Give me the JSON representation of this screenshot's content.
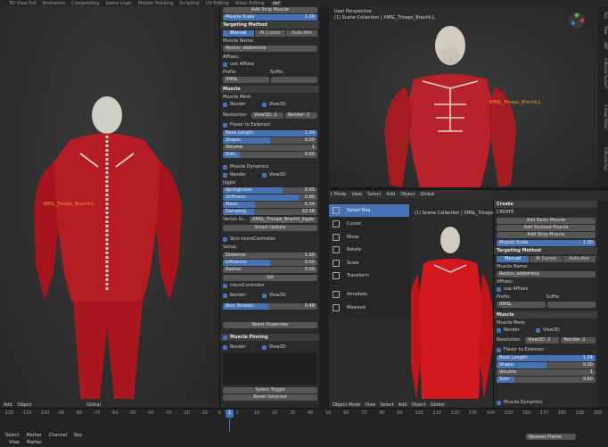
{
  "workspace_tabs": [
    "3D View Full",
    "Animation",
    "Compositing",
    "Game Logic",
    "Motion Tracking",
    "Scripting",
    "UV Editing",
    "Video Editing",
    "def"
  ],
  "left_viewport": {
    "bone_label": "XMSL_Triceps_Brachii.L",
    "footer": {
      "add": "Add",
      "object": "Object",
      "global": "Global"
    }
  },
  "top_right_viewport": {
    "title": "User Perspective",
    "subtitle": "(1) Scene Collection | XMSL_Triceps_Brachii.L",
    "bone_label": "XMSL_Triceps_Brachii.L",
    "side_tabs": [
      "Tool",
      "View",
      "ARP",
      "X-Muscle System",
      "X-Poser Picker",
      "X Muscle Sys"
    ]
  },
  "mid_panel": {
    "top_partial": {
      "add_strip": "Add Strip Muscle",
      "muscle_scale_label": "Muscle Scale",
      "muscle_scale_value": "1.00"
    },
    "targeting": {
      "header": "Targeting Method",
      "modes": [
        "Manual",
        "At Cursor",
        "Auto Aim"
      ],
      "muscle_name_label": "Muscle Name:",
      "muscle_name": "Rectus_abdominis",
      "affixes_label": "Affixes:",
      "use_affixes": "use Affixes",
      "prefix_label": "Prefix:",
      "suffix_label": "Suffix:",
      "prefix_value": "XMSL"
    },
    "muscle": {
      "header": "Muscle",
      "mesh_label": "Muscle Mesh",
      "render": "Render",
      "view3d": "View3D",
      "resolution_label": "Resolution:",
      "view3d_res": "View3D: 2",
      "render_res": "Render: 2",
      "flexor": "Flexor to Extensor",
      "base_length_label": "Base Length:",
      "base_length": "1.04",
      "shape_label": "Shape:",
      "shape": "0.00",
      "volume_label": "Volume:",
      "volume": "1",
      "size_label": "Size:",
      "size": "0.60"
    },
    "dynamics": {
      "header": "Muscle Dynamics",
      "render": "Render",
      "view3d": "View3D",
      "jiggle_label": "Jiggle:",
      "springiness_label": "Springiness:",
      "springiness": "0.63",
      "stiffness_label": "Stiffness:",
      "stiffness": "0.80",
      "mass_label": "Mass:",
      "mass": "0.34",
      "damping_label": "Damping:",
      "damping": "32.58",
      "vertex_group_label": "Vertex Gr...",
      "vertex_group": "XMSL_Triceps_Brachii_jiggle",
      "smart_update": "Smart Update"
    },
    "micro": {
      "header": "Skin microController",
      "setup_label": "Setup:",
      "distance_label": "Distance:",
      "distance": "1.00",
      "influence_label": "Influence:",
      "influence": "0.50",
      "radius_label": "Radius:",
      "radius": "0.50",
      "set": "Set",
      "microcontroller": "microController",
      "render": "Render",
      "view3d": "View3D",
      "skin_tension_label": "Skin Tension:",
      "skin_tension": "0.48",
      "reset": "Reset Properties"
    },
    "pinning": {
      "header": "Muscle Pinning",
      "render": "Render",
      "view3d": "View3D",
      "select_toggle": "Select Toggle",
      "reset_selected": "Reset Selected"
    }
  },
  "bottom_right": {
    "header_menus": [
      "t Mode",
      "View",
      "Select",
      "Add",
      "Object",
      "Global"
    ],
    "scene_label": "(1) Scene Collection | XMSL_Triceps_Brachii",
    "tools": [
      "Select Box",
      "Cursor",
      "Move",
      "Rotate",
      "Scale",
      "Transform",
      "Annotate",
      "Measure"
    ],
    "footer": [
      "Object Mode",
      "View",
      "Select",
      "Add",
      "Object",
      "Global"
    ],
    "panel": {
      "create_header": "Create",
      "create_label": "CREATE:",
      "add_basic": "Add Basic Muscle",
      "add_stylized": "Add Stylized Muscle",
      "add_strip": "Add Strip Muscle",
      "muscle_scale_label": "Muscle Scale",
      "muscle_scale": "1.00",
      "targeting": "Targeting Method",
      "modes": [
        "Manual",
        "At Cursor",
        "Auto Aim"
      ],
      "muscle_name_label": "Muscle Name:",
      "muscle_name": "Rectus_abdominis",
      "affixes_label": "Affixes:",
      "use_affixes": "use Affixes",
      "prefix_label": "Prefix:",
      "suffix_label": "Suffix:",
      "prefix": "XMSL",
      "muscle_header": "Muscle",
      "mesh_label": "Muscle Mesh",
      "render": "Render",
      "view3d": "View3D",
      "resolution_label": "Resolution:",
      "view3d_res": "View3D: 2",
      "render_res": "Render: 2",
      "flexor": "Flexor to Extensor",
      "base_length_label": "Base Length:",
      "base_length": "1.04",
      "shape_label": "Shape:",
      "shape": "0.00",
      "volume_label": "Volume:",
      "volume": "1",
      "size_label": "Size:",
      "size": "0.60",
      "dynamics": "Muscle Dynamics"
    }
  },
  "timeline": {
    "ticks": [
      "-120",
      "-110",
      "-100",
      "-90",
      "-80",
      "-70",
      "-60",
      "-50",
      "-40",
      "-30",
      "-20",
      "-10",
      "0",
      "1",
      "10",
      "20",
      "30",
      "40",
      "50",
      "60",
      "70",
      "80",
      "90",
      "100",
      "110",
      "120",
      "130",
      "140",
      "150",
      "160",
      "170",
      "180",
      "190",
      "200"
    ],
    "current_frame": "1",
    "menus": [
      "Select",
      "Marker",
      "Channel",
      "Key"
    ],
    "row2": [
      "View",
      "Marker"
    ],
    "nearest_frame": "Nearest Frame"
  }
}
